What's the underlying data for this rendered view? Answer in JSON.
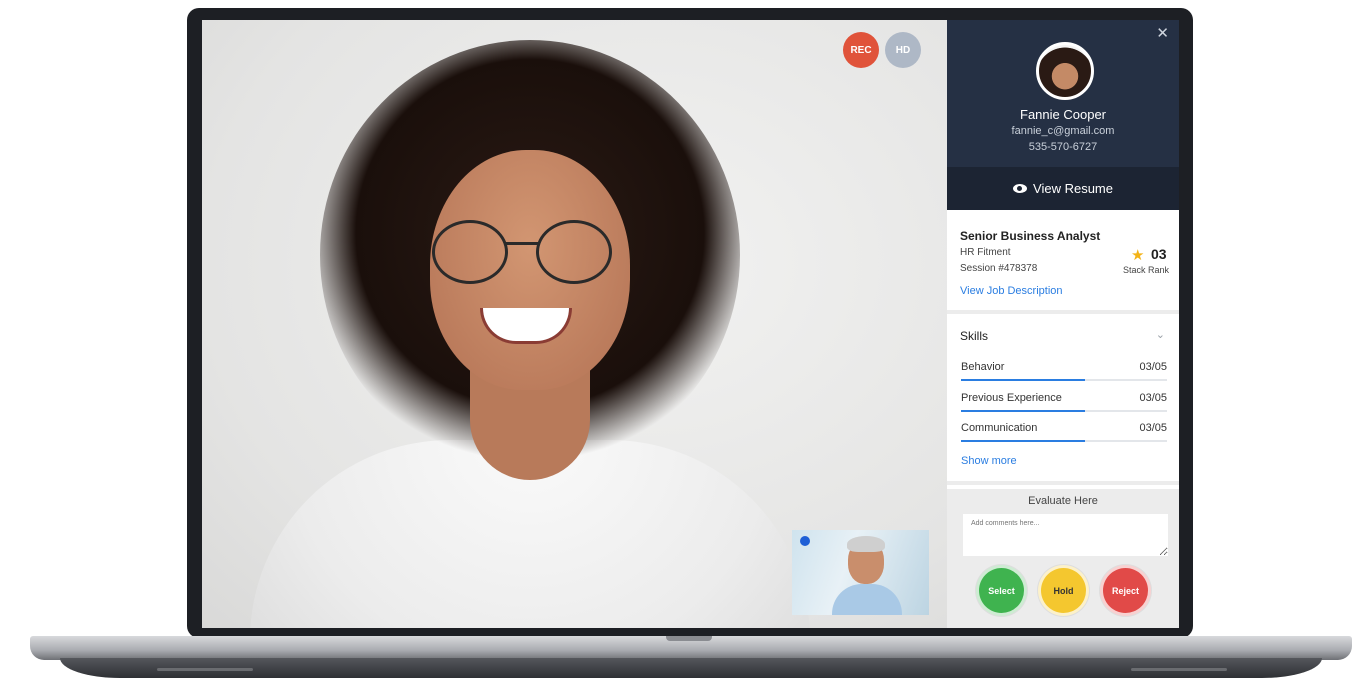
{
  "call": {
    "rec_label": "REC",
    "hd_label": "HD"
  },
  "candidate": {
    "name": "Fannie Cooper",
    "email": "fannie_c@gmail.com",
    "phone": "535-570-6727",
    "view_resume_label": "View Resume"
  },
  "job": {
    "title": "Senior Business Analyst",
    "type": "HR Fitment",
    "session": "Session #478378",
    "rank_value": "03",
    "rank_label": "Stack Rank",
    "view_description_label": "View Job Description"
  },
  "skills": {
    "title": "Skills",
    "items": [
      {
        "name": "Behavior",
        "score": "03/05",
        "fraction": 0.6
      },
      {
        "name": "Previous Experience",
        "score": "03/05",
        "fraction": 0.6
      },
      {
        "name": "Communication",
        "score": "03/05",
        "fraction": 0.6
      }
    ],
    "show_more_label": "Show more"
  },
  "evaluate": {
    "title": "Evaluate Here",
    "comment_placeholder": "Add comments here...",
    "select_label": "Select",
    "hold_label": "Hold",
    "reject_label": "Reject"
  },
  "colors": {
    "panel_dark": "#253044",
    "accent_blue": "#2a7de1",
    "rec_red": "#e0533a",
    "select_green": "#3fb34f",
    "hold_yellow": "#f4c72f",
    "reject_red": "#e14a48",
    "star_gold": "#f3b317"
  }
}
